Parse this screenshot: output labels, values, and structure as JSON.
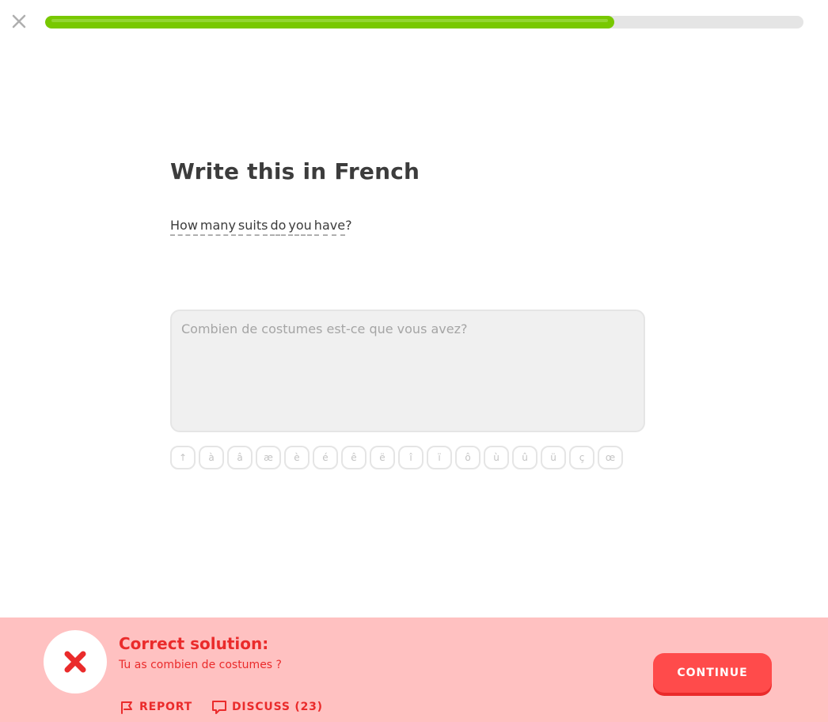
{
  "header": {
    "close_icon": "close-icon",
    "progress_fraction": 0.75
  },
  "challenge": {
    "title": "Write this in French",
    "prompt_words": [
      "How",
      "many",
      "suits",
      "do",
      "you",
      "have",
      "?"
    ],
    "answer_value": "Combien de costumes est-ce que vous avez?"
  },
  "keyboard": {
    "keys": [
      "↑",
      "à",
      "â",
      "æ",
      "è",
      "é",
      "ê",
      "ë",
      "î",
      "ï",
      "ô",
      "ù",
      "û",
      "ü",
      "ç",
      "œ"
    ]
  },
  "feedback": {
    "status_icon": "x-icon",
    "title": "Correct solution:",
    "solution": "Tu as combien de costumes ?",
    "report_label": "REPORT",
    "discuss_label": "DISCUSS (23)",
    "continue_label": "CONTINUE",
    "colors": {
      "background": "#ffc1c1",
      "text": "#ea2b2b",
      "button": "#ff4b4b"
    }
  }
}
